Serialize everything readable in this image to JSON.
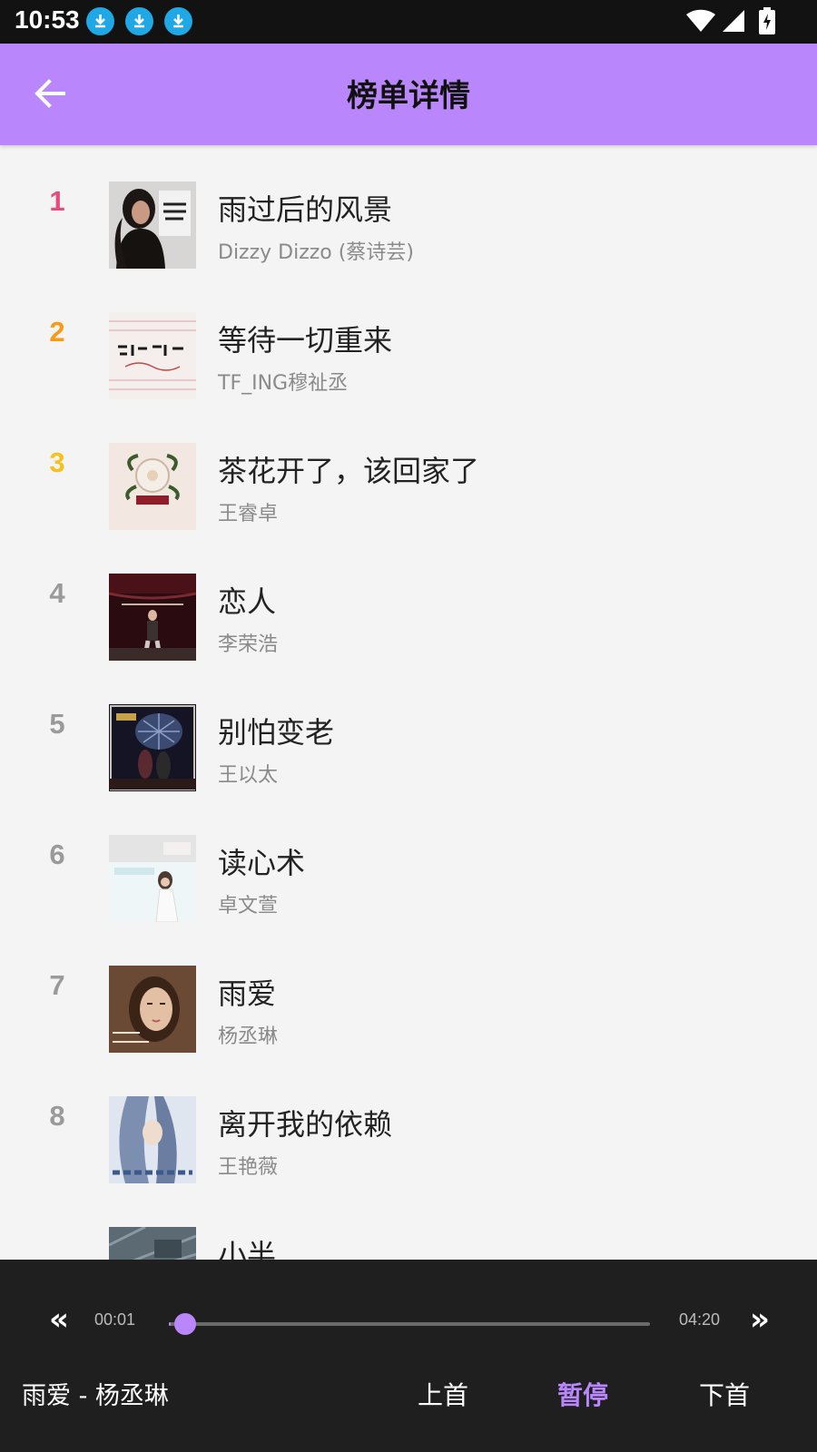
{
  "status_bar": {
    "time": "10:53",
    "download_icons": [
      "download-icon",
      "download-icon",
      "download-icon"
    ],
    "right_icons": [
      "wifi-icon",
      "signal-icon",
      "battery-charging-icon"
    ]
  },
  "header": {
    "title": "榜单详情",
    "back_icon": "arrow-left-icon",
    "color": "#b987fb"
  },
  "rank_colors": {
    "1": "#e84a7f",
    "2": "#f59a1a",
    "3": "#f5c11a",
    "default": "#9a9a9a"
  },
  "songs": [
    {
      "rank": "1",
      "title": "雨过后的风景",
      "artist": "Dizzy Dizzo (蔡诗芸)"
    },
    {
      "rank": "2",
      "title": "等待一切重来",
      "artist": "TF_ING穆祉丞"
    },
    {
      "rank": "3",
      "title": "茶花开了，该回家了",
      "artist": "王睿卓"
    },
    {
      "rank": "4",
      "title": "恋人",
      "artist": "李荣浩"
    },
    {
      "rank": "5",
      "title": "别怕变老",
      "artist": "王以太"
    },
    {
      "rank": "6",
      "title": "读心术",
      "artist": "卓文萱"
    },
    {
      "rank": "7",
      "title": "雨爱",
      "artist": "杨丞琳"
    },
    {
      "rank": "8",
      "title": "离开我的依赖",
      "artist": "王艳薇"
    },
    {
      "rank": "",
      "title": "小半",
      "artist": ""
    }
  ],
  "player": {
    "prev_label": "«",
    "next_label": "»",
    "current_time": "00:01",
    "duration": "04:20",
    "progress_fraction": 0.004,
    "now_playing": "雨爱 - 杨丞琳",
    "prev_button": "上首",
    "pause_button": "暂停",
    "next_button": "下首"
  }
}
